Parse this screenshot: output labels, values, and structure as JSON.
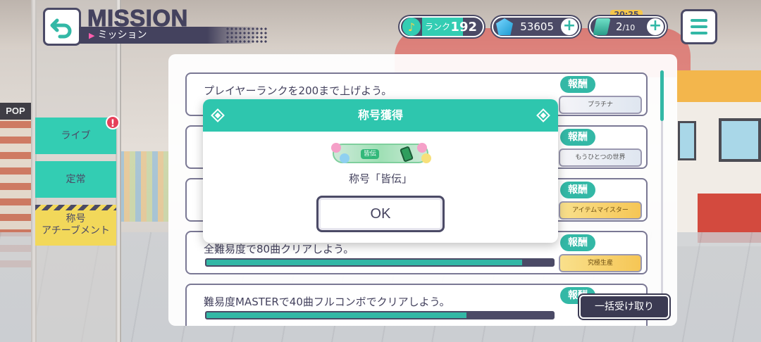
{
  "header": {
    "title_en": "MISSION",
    "title_jp": "ミッション",
    "rank_label": "ランク",
    "rank_value": "192",
    "crystals": "53605",
    "stamina": "2",
    "stamina_max": "/10",
    "timer": "20:25"
  },
  "side_tabs": [
    {
      "label": "ライブ"
    },
    {
      "label": "定常"
    },
    {
      "label_line1": "称号",
      "label_line2": "アチーブメント"
    }
  ],
  "badge": "!",
  "missions": [
    {
      "desc": "プレイヤーランクを200まで上げよう。",
      "reward_label": "報酬",
      "reward_plate": "プラチナ"
    },
    {
      "desc": "",
      "reward_label": "報酬",
      "reward_plate": "もうひとつの世界"
    },
    {
      "desc": "",
      "reward_label": "報酬",
      "reward_plate": "アイテムマイスター"
    },
    {
      "desc": "全難易度で80曲クリアしよう。",
      "reward_label": "報酬",
      "reward_plate": "究極生産",
      "progress": 0.91
    },
    {
      "desc": "難易度MASTERで40曲フルコンボでクリアしよう。",
      "reward_label": "報酬",
      "progress": 0.75
    }
  ],
  "bulk_button": "一括受け取り",
  "modal": {
    "header": "称号獲得",
    "plate_tag": "皆伝",
    "text": "称号「皆伝」",
    "ok": "OK"
  },
  "colors": {
    "accent": "#33b8a6",
    "modal_header": "#2ec6ae",
    "dark": "#4b4a66",
    "badge": "#e6405a",
    "tab_yellow": "#f2d85a"
  },
  "icons": [
    "back-arrow-icon",
    "music-note-icon",
    "crystal-icon",
    "stamina-icon",
    "plus-icon",
    "menu-icon",
    "diamond-icon"
  ]
}
